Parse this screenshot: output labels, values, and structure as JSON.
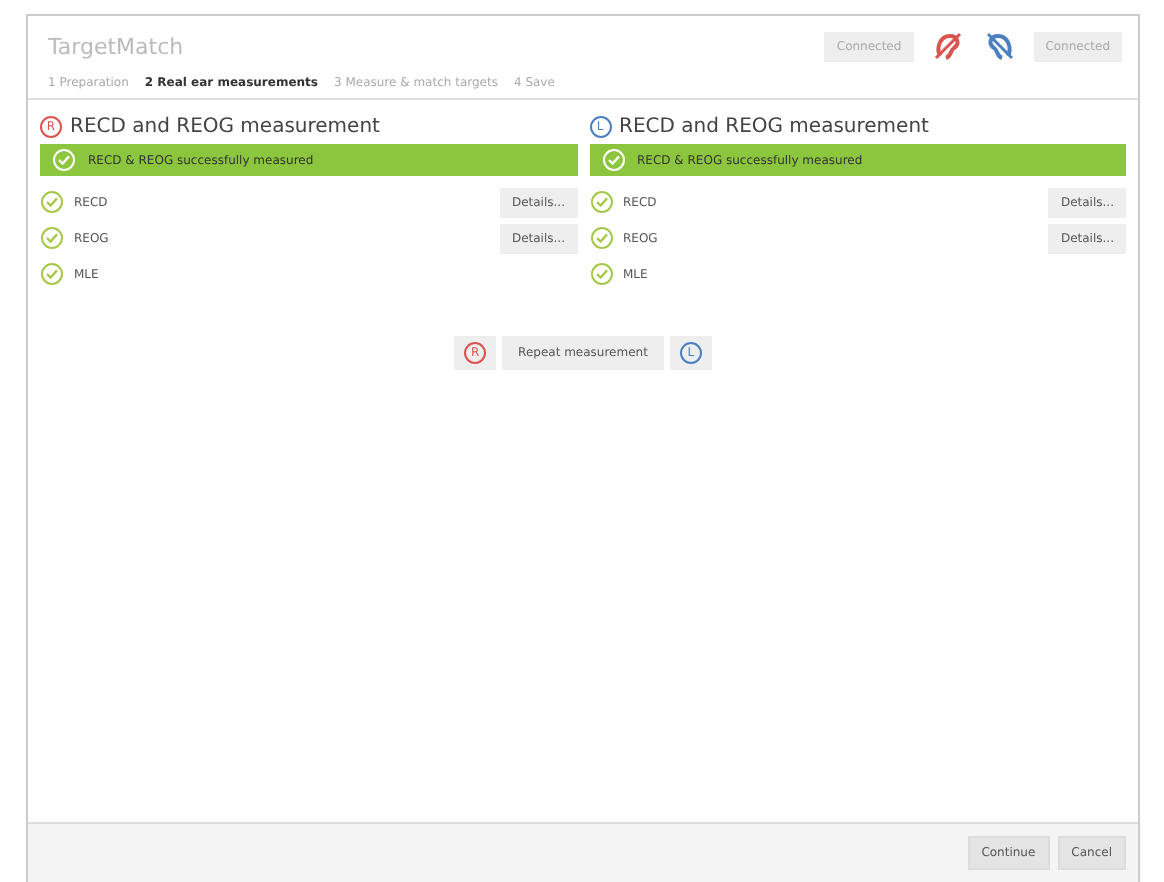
{
  "window": {
    "title": "TargetMatch"
  },
  "connections": [
    {
      "label": "Connected",
      "color": "#d9534f"
    },
    {
      "label": "Connected",
      "color": "#4a7fc1"
    }
  ],
  "steps": [
    {
      "label": "1 Preparation",
      "selected": false
    },
    {
      "label": "2 Real ear measurements",
      "selected": true
    },
    {
      "label": "3 Measure & match targets",
      "selected": false
    },
    {
      "label": "4 Save",
      "selected": false
    }
  ],
  "panels": [
    {
      "badge": "R",
      "color": "#d9534f",
      "title": "RECD and REOG measurement",
      "banner": "RECD & REOG successfully measured",
      "items": [
        {
          "label": "RECD",
          "button": "Details..."
        },
        {
          "label": "REOG",
          "button": "Details..."
        },
        {
          "label": "MLE"
        }
      ]
    },
    {
      "badge": "L",
      "color": "#4a7fc1",
      "title": "RECD and REOG measurement",
      "banner": "RECD & REOG successfully measured",
      "items": [
        {
          "label": "RECD",
          "button": "Details..."
        },
        {
          "label": "REOG",
          "button": "Details..."
        },
        {
          "label": "MLE"
        }
      ]
    }
  ],
  "repeat": {
    "left_badge": "R",
    "label": "Repeat measurement",
    "right_badge": "L"
  },
  "footer_buttons": [
    "Continue",
    "Cancel"
  ]
}
